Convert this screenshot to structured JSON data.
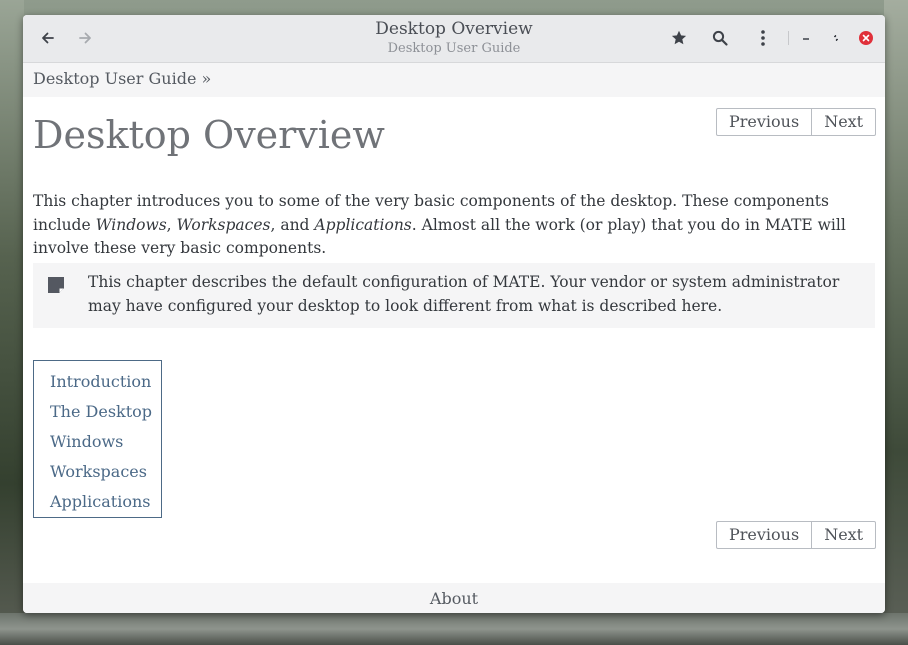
{
  "window": {
    "title": "Desktop Overview",
    "subtitle": "Desktop User Guide"
  },
  "toolbar": {
    "back_icon": "arrow-left-icon",
    "forward_icon": "arrow-right-icon",
    "bookmark_icon": "star-icon",
    "search_icon": "search-icon",
    "menu_icon": "vertical-dots-icon",
    "minimize_icon": "minimize-icon",
    "restore_icon": "restore-icon",
    "close_icon": "close-icon",
    "close_color": "#e0303a"
  },
  "breadcrumb": {
    "text": "Desktop User Guide »"
  },
  "page": {
    "title": "Desktop Overview",
    "previous_label": "Previous",
    "next_label": "Next",
    "intro_part1": "This chapter introduces you to some of the very basic components of the desktop. These components include ",
    "intro_em1": "Windows",
    "intro_part2": ", ",
    "intro_em2": "Workspaces",
    "intro_part3": ", and ",
    "intro_em3": "Applications",
    "intro_part4": ". Almost all the work (or play) that you do in MATE will involve these very basic components.",
    "note_icon": "note-icon",
    "note_text": "This chapter describes the default configuration of MATE. Your vendor or system administrator may have configured your desktop to look different from what is described here."
  },
  "toc": {
    "items": [
      "Introduction",
      "The Desktop",
      "Windows",
      "Workspaces",
      "Applications"
    ]
  },
  "footer": {
    "about_label": "About"
  },
  "colors": {
    "link": "#4b6987",
    "header_bg": "#e9eaec",
    "text": "#34383d"
  }
}
